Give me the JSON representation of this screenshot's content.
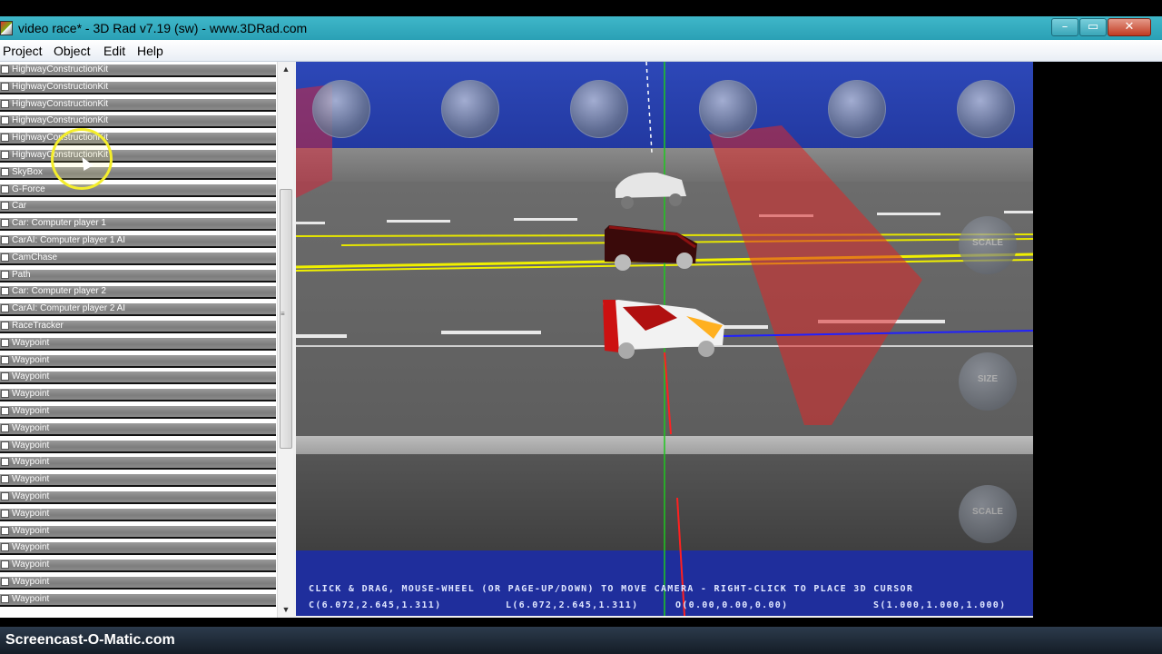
{
  "window": {
    "title": "video race* - 3D Rad v7.19 (sw) - www.3DRad.com",
    "controls": {
      "minimize": "–",
      "maximize": "▭",
      "close": "✕"
    }
  },
  "menu": {
    "items": [
      "Project",
      "Object",
      "Edit",
      "Help"
    ]
  },
  "object_list": {
    "items": [
      "HighwayConstructionKit",
      "HighwayConstructionKit",
      "HighwayConstructionKit",
      "HighwayConstructionKit",
      "HighwayConstructionKit",
      "HighwayConstructionKit",
      "SkyBox",
      "G-Force",
      "Car",
      "Car: Computer player 1",
      "CarAI: Computer player 1 AI",
      "CamChase",
      "Path",
      "Car: Computer player 2",
      "CarAI: Computer player 2 AI",
      "RaceTracker",
      "Waypoint",
      "Waypoint",
      "Waypoint",
      "Waypoint",
      "Waypoint",
      "Waypoint",
      "Waypoint",
      "Waypoint",
      "Waypoint",
      "Waypoint",
      "Waypoint",
      "Waypoint",
      "Waypoint",
      "Waypoint",
      "Waypoint",
      "Waypoint"
    ]
  },
  "viewport": {
    "side_buttons": [
      "SCALE",
      "SIZE",
      "SCALE"
    ],
    "instructions": "CLICK & DRAG, MOUSE-WHEEL (OR PAGE-UP/DOWN) TO MOVE CAMERA - RIGHT-CLICK TO PLACE 3D CURSOR",
    "coords": {
      "c": "C(6.072,2.645,1.311)",
      "l": "L(6.072,2.645,1.311)",
      "o": "O(0.00,0.00,0.00)",
      "s": "S(1.000,1.000,1.000)"
    }
  },
  "watermark": "Screencast-O-Matic.com"
}
